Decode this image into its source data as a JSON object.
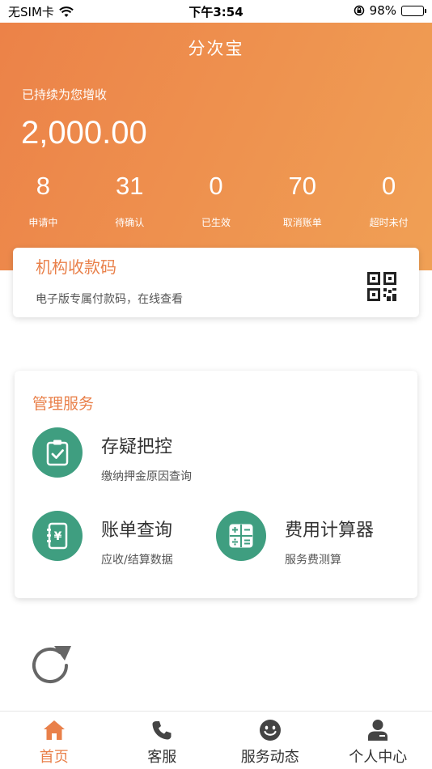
{
  "status_bar": {
    "carrier": "无SIM卡",
    "time": "下午3:54",
    "battery": "98%"
  },
  "header": {
    "title": "分次宝",
    "subtitle": "已持续为您增收",
    "amount": "2,000.00"
  },
  "stats": [
    {
      "value": "8",
      "label": "申请中"
    },
    {
      "value": "31",
      "label": "待确认"
    },
    {
      "value": "0",
      "label": "已生效"
    },
    {
      "value": "70",
      "label": "取消账单"
    },
    {
      "value": "0",
      "label": "超时未付"
    }
  ],
  "payment_card": {
    "title": "机构收款码",
    "description": "电子版专属付款码，在线查看",
    "icon": "qr-code-icon"
  },
  "services": {
    "title": "管理服务",
    "items": [
      {
        "name": "存疑把控",
        "note": "缴纳押金原因查询",
        "icon": "clipboard-check-icon"
      },
      {
        "name": "账单查询",
        "note": "应收/结算数据",
        "icon": "bill-yuan-icon"
      },
      {
        "name": "费用计算器",
        "note": "服务费测算",
        "icon": "calculator-icon"
      }
    ]
  },
  "tabs": [
    {
      "label": "首页",
      "icon": "home-icon",
      "active": true
    },
    {
      "label": "客服",
      "icon": "phone-icon",
      "active": false
    },
    {
      "label": "服务动态",
      "icon": "smile-icon",
      "active": false
    },
    {
      "label": "个人中心",
      "icon": "person-icon",
      "active": false
    }
  ],
  "colors": {
    "accent": "#e9804a",
    "service_green": "#3f9e80",
    "gradient_start": "#ec8248",
    "gradient_end": "#f0a055"
  }
}
